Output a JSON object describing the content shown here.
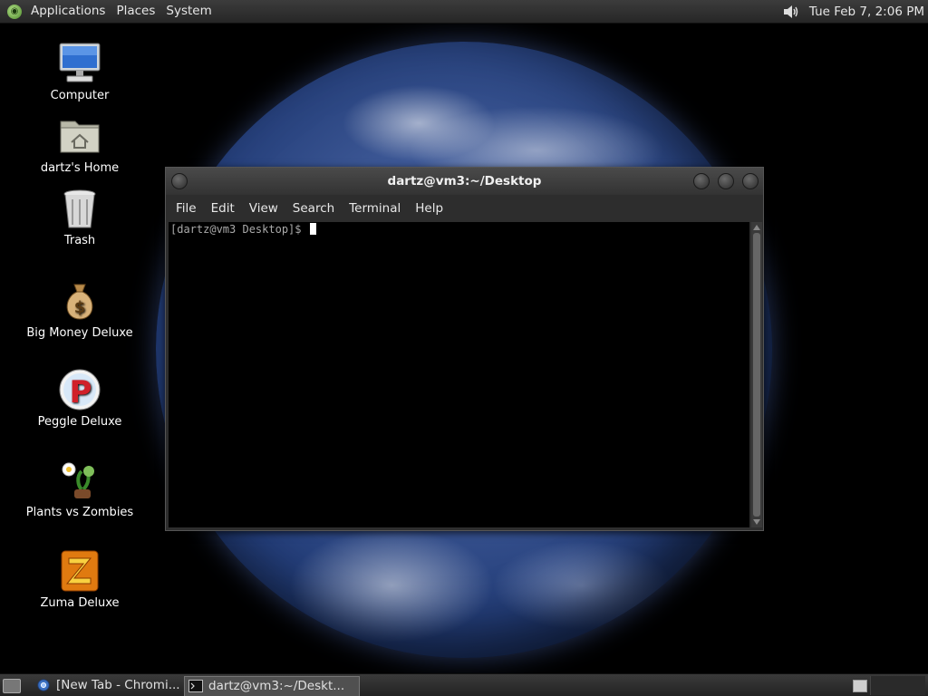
{
  "top_panel": {
    "menus": [
      "Applications",
      "Places",
      "System"
    ],
    "clock": "Tue Feb  7,  2:06 PM",
    "volume_icon": "speaker-icon"
  },
  "desktop": {
    "icons": [
      {
        "label": "Computer",
        "icon": "computer-icon"
      },
      {
        "label": "dartz's Home",
        "icon": "home-folder-icon"
      },
      {
        "label": "Trash",
        "icon": "trash-icon"
      },
      {
        "label": "Big Money Deluxe",
        "icon": "money-bag-icon"
      },
      {
        "label": "Peggle Deluxe",
        "icon": "peggle-icon"
      },
      {
        "label": "Plants vs Zombies",
        "icon": "plant-icon"
      },
      {
        "label": "Zuma Deluxe",
        "icon": "zuma-icon"
      }
    ]
  },
  "terminal": {
    "title": "dartz@vm3:~/Desktop",
    "menus": [
      "File",
      "Edit",
      "View",
      "Search",
      "Terminal",
      "Help"
    ],
    "prompt": "[dartz@vm3 Desktop]$"
  },
  "bottom_panel": {
    "tasks": [
      {
        "label": "[New Tab - Chromi...",
        "icon": "chromium-icon"
      },
      {
        "label": "dartz@vm3:~/Deskt...",
        "icon": "terminal-icon"
      }
    ]
  },
  "colors": {
    "panel": "#2e2e2e",
    "terminal_bg": "#000000",
    "text": "#e6e6e6"
  }
}
